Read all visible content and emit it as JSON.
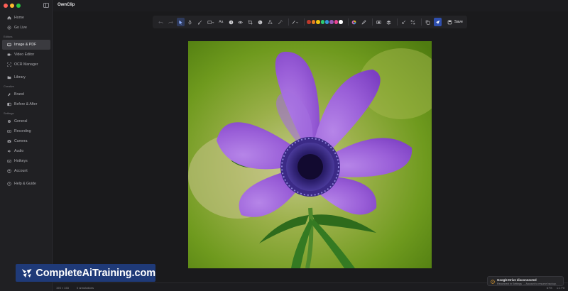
{
  "app": {
    "title": "OwnClip"
  },
  "window_controls": {
    "close_color": "#ff5f57",
    "minimize_color": "#febc2e",
    "zoom_color": "#28c840"
  },
  "sidebar": {
    "top_items": [
      {
        "label": "Home",
        "icon": "home-icon"
      },
      {
        "label": "Go Live",
        "icon": "broadcast-icon"
      }
    ],
    "sections": [
      {
        "title": "Editors",
        "items": [
          {
            "label": "Image & PDF",
            "icon": "image-icon",
            "active": true
          },
          {
            "label": "Video Editor",
            "icon": "video-icon"
          },
          {
            "label": "OCR Manager",
            "icon": "ocr-icon"
          }
        ]
      },
      {
        "title": "",
        "items": [
          {
            "label": "Library",
            "icon": "folder-icon"
          }
        ]
      },
      {
        "title": "Creative",
        "items": [
          {
            "label": "Brand",
            "icon": "brand-icon"
          },
          {
            "label": "Before & After",
            "icon": "split-icon"
          }
        ]
      },
      {
        "title": "Settings",
        "items": [
          {
            "label": "General",
            "icon": "gear-icon"
          },
          {
            "label": "Recording",
            "icon": "record-icon"
          },
          {
            "label": "Camera",
            "icon": "camera-icon"
          },
          {
            "label": "Audio",
            "icon": "audio-icon"
          },
          {
            "label": "Hotkeys",
            "icon": "keyboard-icon"
          },
          {
            "label": "Account",
            "icon": "account-icon"
          }
        ]
      },
      {
        "title": "",
        "items": [
          {
            "label": "Help & Guide",
            "icon": "help-icon"
          }
        ]
      }
    ]
  },
  "toolbar": {
    "text_tool_label": "Aa",
    "save_label": "Save",
    "colors": [
      "#c0392b",
      "#e67e22",
      "#f1c40f",
      "#2ecc71",
      "#3498db",
      "#9b59b6",
      "#e84393",
      "#ffffff"
    ]
  },
  "status": {
    "dimensions": "193 × 153",
    "annotations": "0 annotations",
    "zoom": "67%",
    "fit": "1:1  Fit"
  },
  "toast": {
    "title": "Google Drive disconnected",
    "message": "Reconnect in Settings → Account to resume backup."
  },
  "watermark": {
    "text": "CompleteAiTraining.com"
  }
}
